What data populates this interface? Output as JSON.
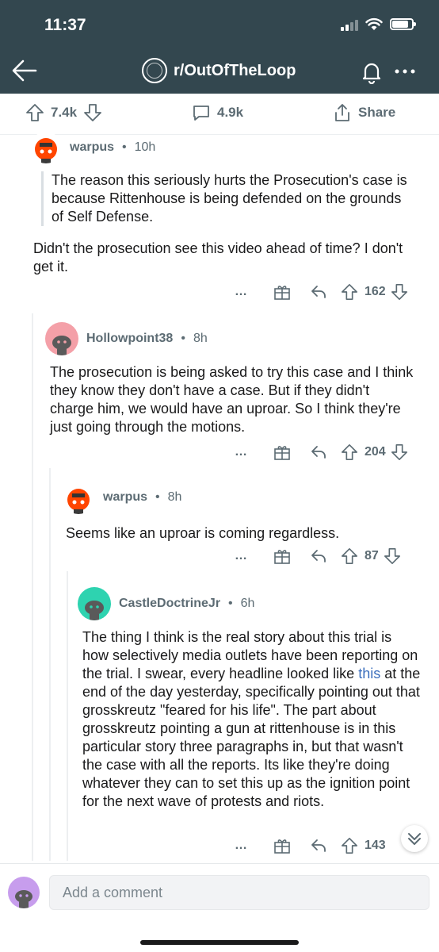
{
  "status_bar": {
    "time": "11:37"
  },
  "header": {
    "subreddit": "r/OutOfTheLoop"
  },
  "post_actions": {
    "upvotes": "7.4k",
    "comments": "4.9k",
    "share": "Share"
  },
  "comments": [
    {
      "author": "warpus",
      "time": "10h",
      "quote": "The reason this seriously hurts the Prosecution's case is because Rittenhouse is being defended on the grounds of Self Defense.",
      "body": "Didn't the prosecution see this video ahead of time?  I don't get it.",
      "score": "162"
    },
    {
      "author": "Hollowpoint38",
      "time": "8h",
      "body": "The prosecution is being asked to try this case and I think they know they don't have a case.  But if they didn't charge him, we would have an uproar.  So I think they're just going through the motions.",
      "score": "204"
    },
    {
      "author": "warpus",
      "time": "8h",
      "body": "Seems like an uproar is coming regardless.",
      "score": "87"
    },
    {
      "author": "CastleDoctrineJr",
      "time": "6h",
      "body_before": "The thing I think is the real story about this trial is how selectively media outlets have been reporting on the trial. I swear, every headline looked like ",
      "link": "this",
      "body_after": " at the end of the day yesterday, specifically pointing out that grosskreutz \"feared for his life\". The part about grosskreutz pointing a gun at rittenhouse is in this particular story three paragraphs in, but that wasn't the case with all the reports. Its like they're doing whatever they can to set this up as the ignition point for the next wave of protests and riots.",
      "score": "143"
    }
  ],
  "more_label": "…",
  "separator": "•",
  "composer": {
    "placeholder": "Add a comment"
  },
  "colors": {
    "header": "#33474f",
    "muted": "#5c6b73",
    "link": "#3c6fbd"
  }
}
